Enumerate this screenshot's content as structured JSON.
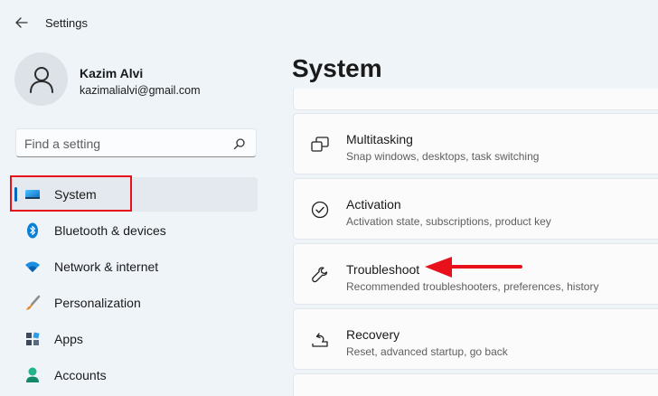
{
  "window": {
    "title": "Settings"
  },
  "profile": {
    "name": "Kazim Alvi",
    "email": "kazimalialvi@gmail.com"
  },
  "search": {
    "placeholder": "Find a setting",
    "value": ""
  },
  "nav": {
    "items": [
      {
        "label": "System",
        "icon": "monitor-icon",
        "active": true
      },
      {
        "label": "Bluetooth & devices",
        "icon": "bluetooth-icon"
      },
      {
        "label": "Network & internet",
        "icon": "wifi-icon"
      },
      {
        "label": "Personalization",
        "icon": "paintbrush-icon"
      },
      {
        "label": "Apps",
        "icon": "apps-icon"
      },
      {
        "label": "Accounts",
        "icon": "person-icon"
      }
    ]
  },
  "main": {
    "title": "System",
    "settings": [
      {
        "title": "Multitasking",
        "subtitle": "Snap windows, desktops, task switching",
        "icon": "multitasking-icon"
      },
      {
        "title": "Activation",
        "subtitle": "Activation state, subscriptions, product key",
        "icon": "check-circle-icon"
      },
      {
        "title": "Troubleshoot",
        "subtitle": "Recommended troubleshooters, preferences, history",
        "icon": "wrench-icon"
      },
      {
        "title": "Recovery",
        "subtitle": "Reset, advanced startup, go back",
        "icon": "recovery-icon"
      }
    ]
  },
  "colors": {
    "accent": "#0067c0",
    "annotation": "#e8101b",
    "background": "#eff4f9",
    "card": "#fbfbfc"
  }
}
